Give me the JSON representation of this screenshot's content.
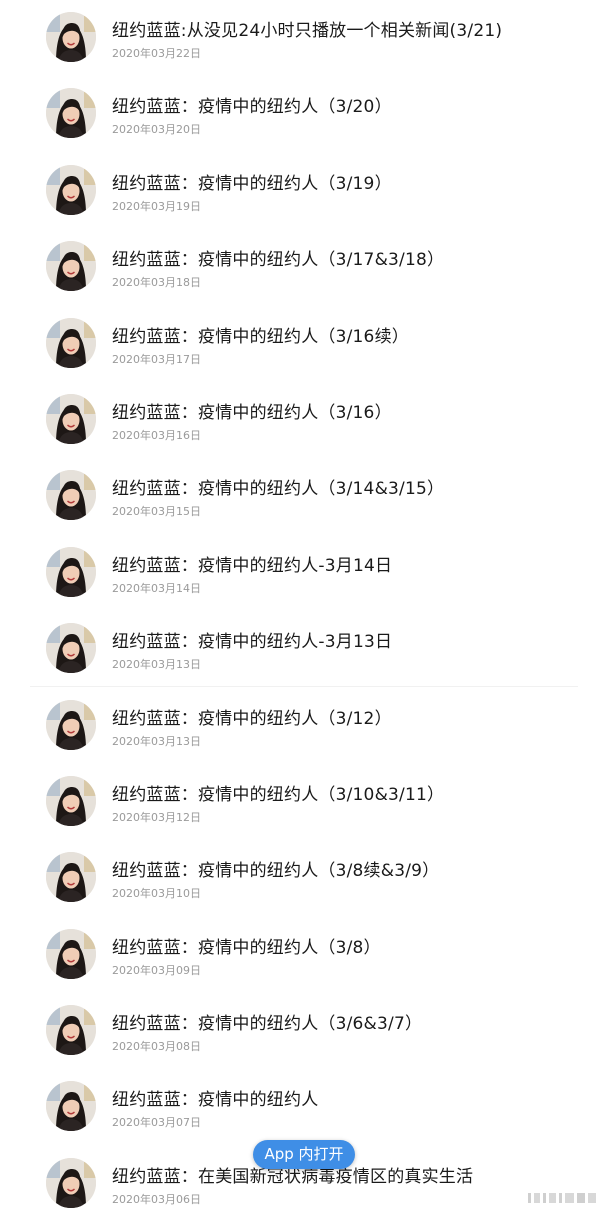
{
  "posts": [
    {
      "title": "纽约蓝蓝:从没见24小时只播放一个相关新闻(3/21)",
      "date": "2020年03月22日"
    },
    {
      "title": "纽约蓝蓝：疫情中的纽约人（3/20）",
      "date": "2020年03月20日"
    },
    {
      "title": "纽约蓝蓝：疫情中的纽约人（3/19）",
      "date": "2020年03月19日"
    },
    {
      "title": "纽约蓝蓝：疫情中的纽约人（3/17&3/18）",
      "date": "2020年03月18日"
    },
    {
      "title": "纽约蓝蓝：疫情中的纽约人（3/16续）",
      "date": "2020年03月17日"
    },
    {
      "title": "纽约蓝蓝：疫情中的纽约人（3/16）",
      "date": "2020年03月16日"
    },
    {
      "title": "纽约蓝蓝：疫情中的纽约人（3/14&3/15）",
      "date": "2020年03月15日"
    },
    {
      "title": "纽约蓝蓝：疫情中的纽约人-3月14日",
      "date": "2020年03月14日"
    },
    {
      "title": "纽约蓝蓝：疫情中的纽约人-3月13日",
      "date": "2020年03月13日"
    },
    {
      "title": "纽约蓝蓝：疫情中的纽约人（3/12）",
      "date": "2020年03月13日"
    },
    {
      "title": "纽约蓝蓝：疫情中的纽约人（3/10&3/11）",
      "date": "2020年03月12日"
    },
    {
      "title": "纽约蓝蓝：疫情中的纽约人（3/8续&3/9）",
      "date": "2020年03月10日"
    },
    {
      "title": "纽约蓝蓝：疫情中的纽约人（3/8）",
      "date": "2020年03月09日"
    },
    {
      "title": "纽约蓝蓝：疫情中的纽约人（3/6&3/7）",
      "date": "2020年03月08日"
    },
    {
      "title": "纽约蓝蓝：疫情中的纽约人",
      "date": "2020年03月07日"
    },
    {
      "title": "纽约蓝蓝：在美国新冠状病毒疫情区的真实生活",
      "date": "2020年03月06日"
    }
  ],
  "open_app_button": {
    "label": "App 内打开"
  },
  "colors": {
    "button_bg": "#3f8ee6",
    "title_text": "#1a1a1a",
    "date_text": "#9a9a9a"
  }
}
